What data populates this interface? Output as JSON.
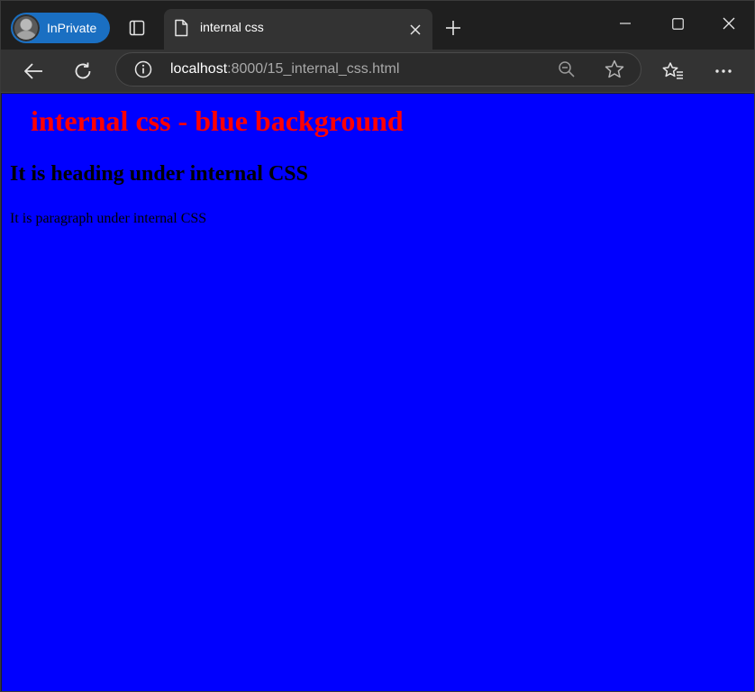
{
  "browser": {
    "profile_label": "InPrivate",
    "tab": {
      "title": "internal css"
    },
    "address": {
      "host": "localhost",
      "path": ":8000/15_internal_css.html"
    },
    "icons": {
      "profile": "avatar-icon",
      "tab_actions": "tab-actions-icon",
      "page": "page-icon",
      "close_tab": "close-icon",
      "new_tab": "plus-icon",
      "minimize": "minimize-icon",
      "maximize": "maximize-icon",
      "close_window": "close-icon",
      "back": "back-arrow-icon",
      "refresh": "refresh-icon",
      "site_info": "info-icon",
      "zoom": "zoom-out-icon",
      "favorite": "star-icon",
      "favorites": "favorites-icon",
      "more": "more-icon"
    },
    "colors": {
      "frame": "#1f1f1f",
      "toolbar": "#333333",
      "inprivate_badge": "#1a6fc2"
    }
  },
  "page": {
    "heading1": "internal css - blue background",
    "heading2": "It is heading under internal CSS",
    "paragraph": "It is paragraph under internal CSS",
    "colors": {
      "background": "#0000ff",
      "heading1": "#ff0000",
      "text": "#000000"
    }
  }
}
